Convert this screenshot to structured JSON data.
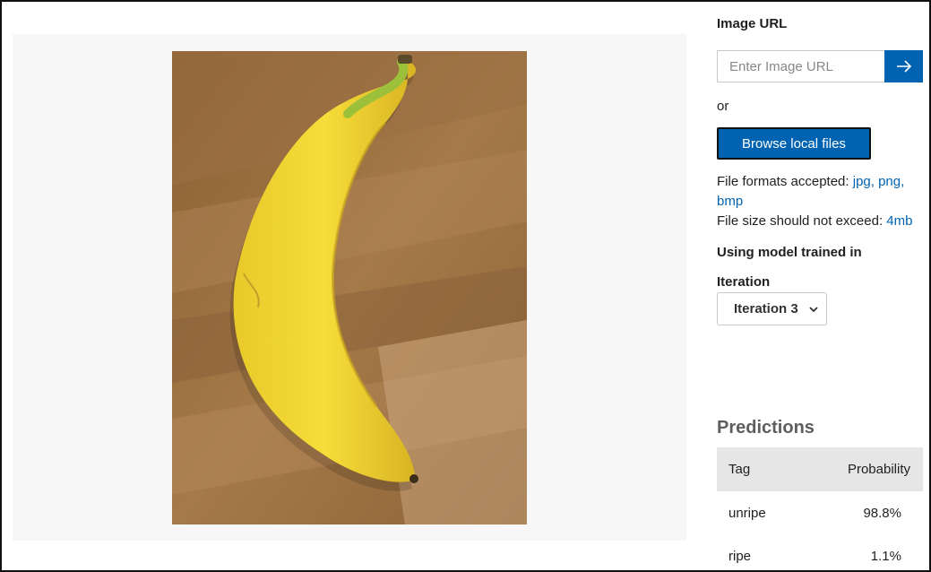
{
  "upload": {
    "image_url_label": "Image URL",
    "url_placeholder": "Enter Image URL",
    "or_label": "or",
    "browse_label": "Browse local files",
    "formats_prefix": "File formats accepted: ",
    "formats_value": "jpg, png, bmp",
    "size_prefix": "File size should not exceed: ",
    "size_value": "4mb"
  },
  "model": {
    "trained_label": "Using model trained in",
    "iteration_label": "Iteration",
    "iteration_selected": "Iteration 3"
  },
  "predictions": {
    "title": "Predictions",
    "columns": [
      "Tag",
      "Probability"
    ],
    "rows": [
      {
        "tag": "unripe",
        "probability": "98.8%"
      },
      {
        "tag": "ripe",
        "probability": "1.1%"
      }
    ]
  },
  "icons": {
    "submit": "arrow-right-icon",
    "dropdown": "chevron-down-icon"
  },
  "colors": {
    "accent": "#0063b1",
    "header_bg": "#e6e6e6",
    "panel_bg": "#f7f7f7"
  }
}
